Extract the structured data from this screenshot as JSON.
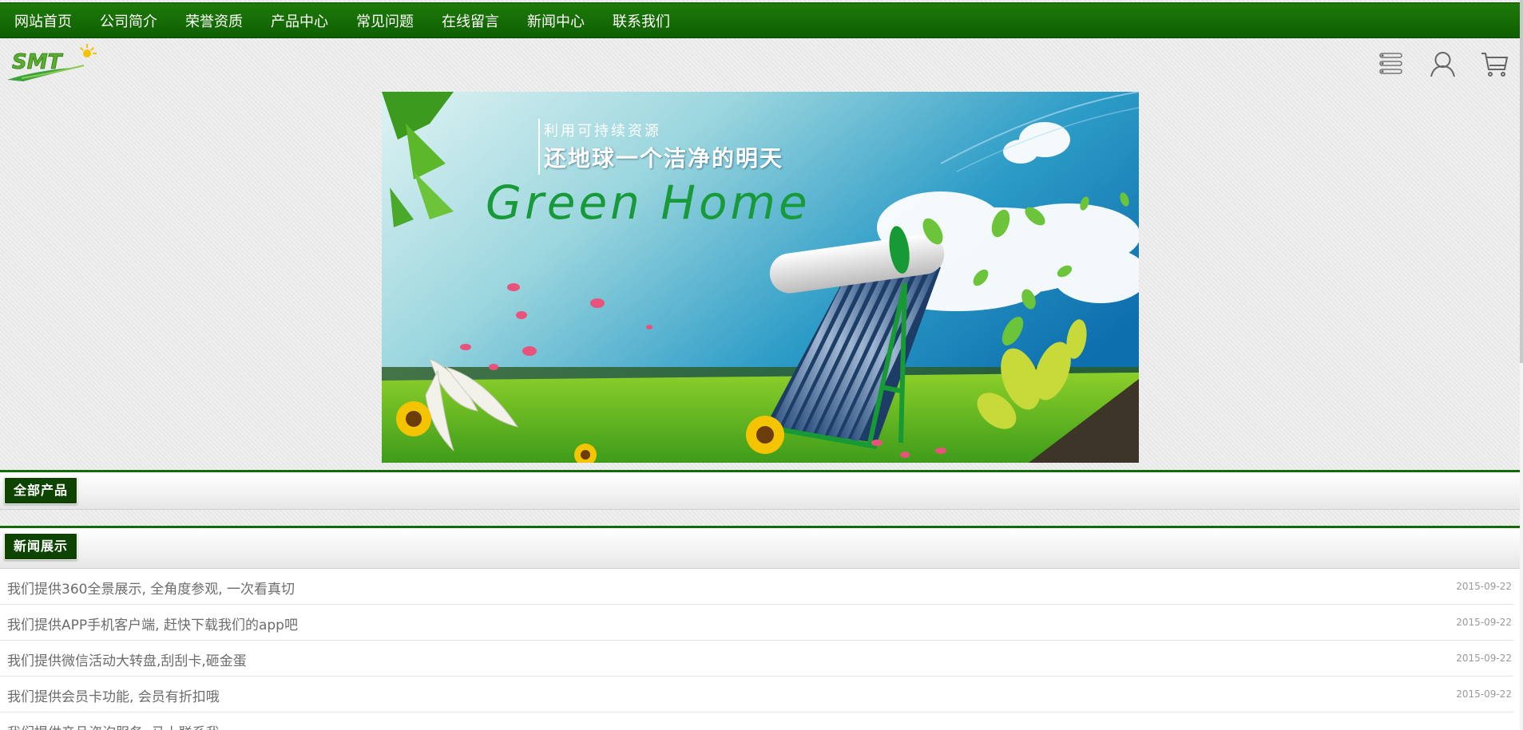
{
  "nav": {
    "items": [
      {
        "label": "网站首页"
      },
      {
        "label": "公司简介"
      },
      {
        "label": "荣誉资质"
      },
      {
        "label": "产品中心"
      },
      {
        "label": "常见问题"
      },
      {
        "label": "在线留言"
      },
      {
        "label": "新闻中心"
      },
      {
        "label": "联系我们"
      }
    ]
  },
  "header": {
    "logo_text": "SMT",
    "icons": [
      "menu-list-icon",
      "user-icon",
      "cart-icon"
    ]
  },
  "banner": {
    "small_text": "利用可持续资源",
    "big_text": "还地球一个洁净的明天",
    "green_text": "Green Home"
  },
  "sections": {
    "products": {
      "title": "全部产品"
    },
    "news": {
      "title": "新闻展示"
    }
  },
  "news": [
    {
      "title": "我们提供360全景展示, 全角度参观, 一次看真切",
      "date": "2015-09-22"
    },
    {
      "title": "我们提供APP手机客户端, 赶快下载我们的app吧",
      "date": "2015-09-22"
    },
    {
      "title": "我们提供微信活动大转盘,刮刮卡,砸金蛋",
      "date": "2015-09-22"
    },
    {
      "title": "我们提供会员卡功能, 会员有折扣哦",
      "date": "2015-09-22"
    },
    {
      "title": "我们提供产品咨询服务, 马上联系我",
      "date": ""
    }
  ],
  "colors": {
    "nav_green": "#126a0a",
    "tab_dark_green": "#0c4400",
    "text_gray": "#6c6c6c"
  }
}
